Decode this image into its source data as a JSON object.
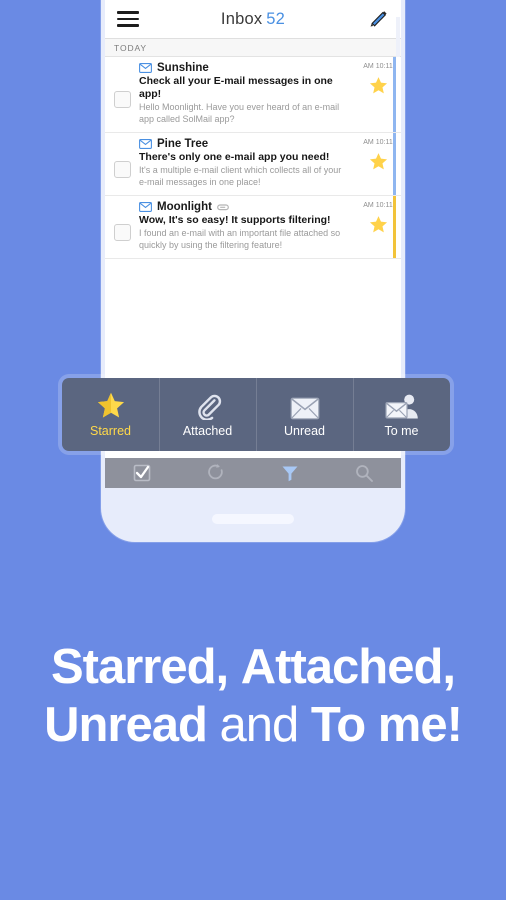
{
  "background_color": "#6a8ae4",
  "accent_color": "#4a90e2",
  "star_color": "#ffd24a",
  "appbar": {
    "menu_icon": "hamburger-menu-icon",
    "title": "Inbox",
    "unread_count": "52",
    "compose_icon": "compose-pen-icon"
  },
  "list": {
    "section_label": "TODAY",
    "rows": [
      {
        "sender": "Sunshine",
        "subject": "Check all your E-mail messages in one app!",
        "preview": "Hello Moonlight. Have you ever heard of an e-mail app called SolMail app?",
        "time": "AM 10:11",
        "starred": true,
        "has_attachment": false,
        "label_color": "#8fb6f0",
        "envelope_icon": "envelope-icon",
        "star_icon": "star-icon",
        "checkbox": "row-checkbox"
      },
      {
        "sender": "Pine Tree",
        "subject": "There's only one e-mail app you need!",
        "preview": "It's a multiple e-mail client which collects all of your e-mail messages in one place!",
        "time": "AM 10:11",
        "starred": true,
        "has_attachment": false,
        "label_color": "#8fb6f0",
        "envelope_icon": "envelope-icon",
        "star_icon": "star-icon",
        "checkbox": "row-checkbox"
      },
      {
        "sender": "Moonlight",
        "subject": "Wow, It's so easy! It supports filtering!",
        "preview": "I found an e-mail with an important file attached so quickly by using the filtering feature!",
        "time": "AM 10:11",
        "starred": true,
        "has_attachment": true,
        "label_color": "#f2c33a",
        "envelope_icon": "envelope-icon",
        "star_icon": "star-icon",
        "attachment_icon": "paperclip-badge-icon",
        "checkbox": "row-checkbox"
      }
    ]
  },
  "filter_bar": {
    "items": [
      {
        "label": "Starred",
        "icon": "star-icon",
        "active": true
      },
      {
        "label": "Attached",
        "icon": "paperclip-icon",
        "active": false
      },
      {
        "label": "Unread",
        "icon": "envelope-icon",
        "active": false
      },
      {
        "label": "To me",
        "icon": "envelope-person-icon",
        "active": false
      }
    ]
  },
  "bottom_toolbar": {
    "items": [
      {
        "name": "select-all-checkbox-icon",
        "active": false
      },
      {
        "name": "refresh-icon",
        "active": false
      },
      {
        "name": "filter-funnel-icon",
        "active": true
      },
      {
        "name": "search-icon",
        "active": false
      }
    ]
  },
  "caption": {
    "line1_a": "Starred,",
    "line1_b": "Attached,",
    "line2_a": "Unread",
    "line2_b": "and",
    "line2_c": "To me!"
  }
}
